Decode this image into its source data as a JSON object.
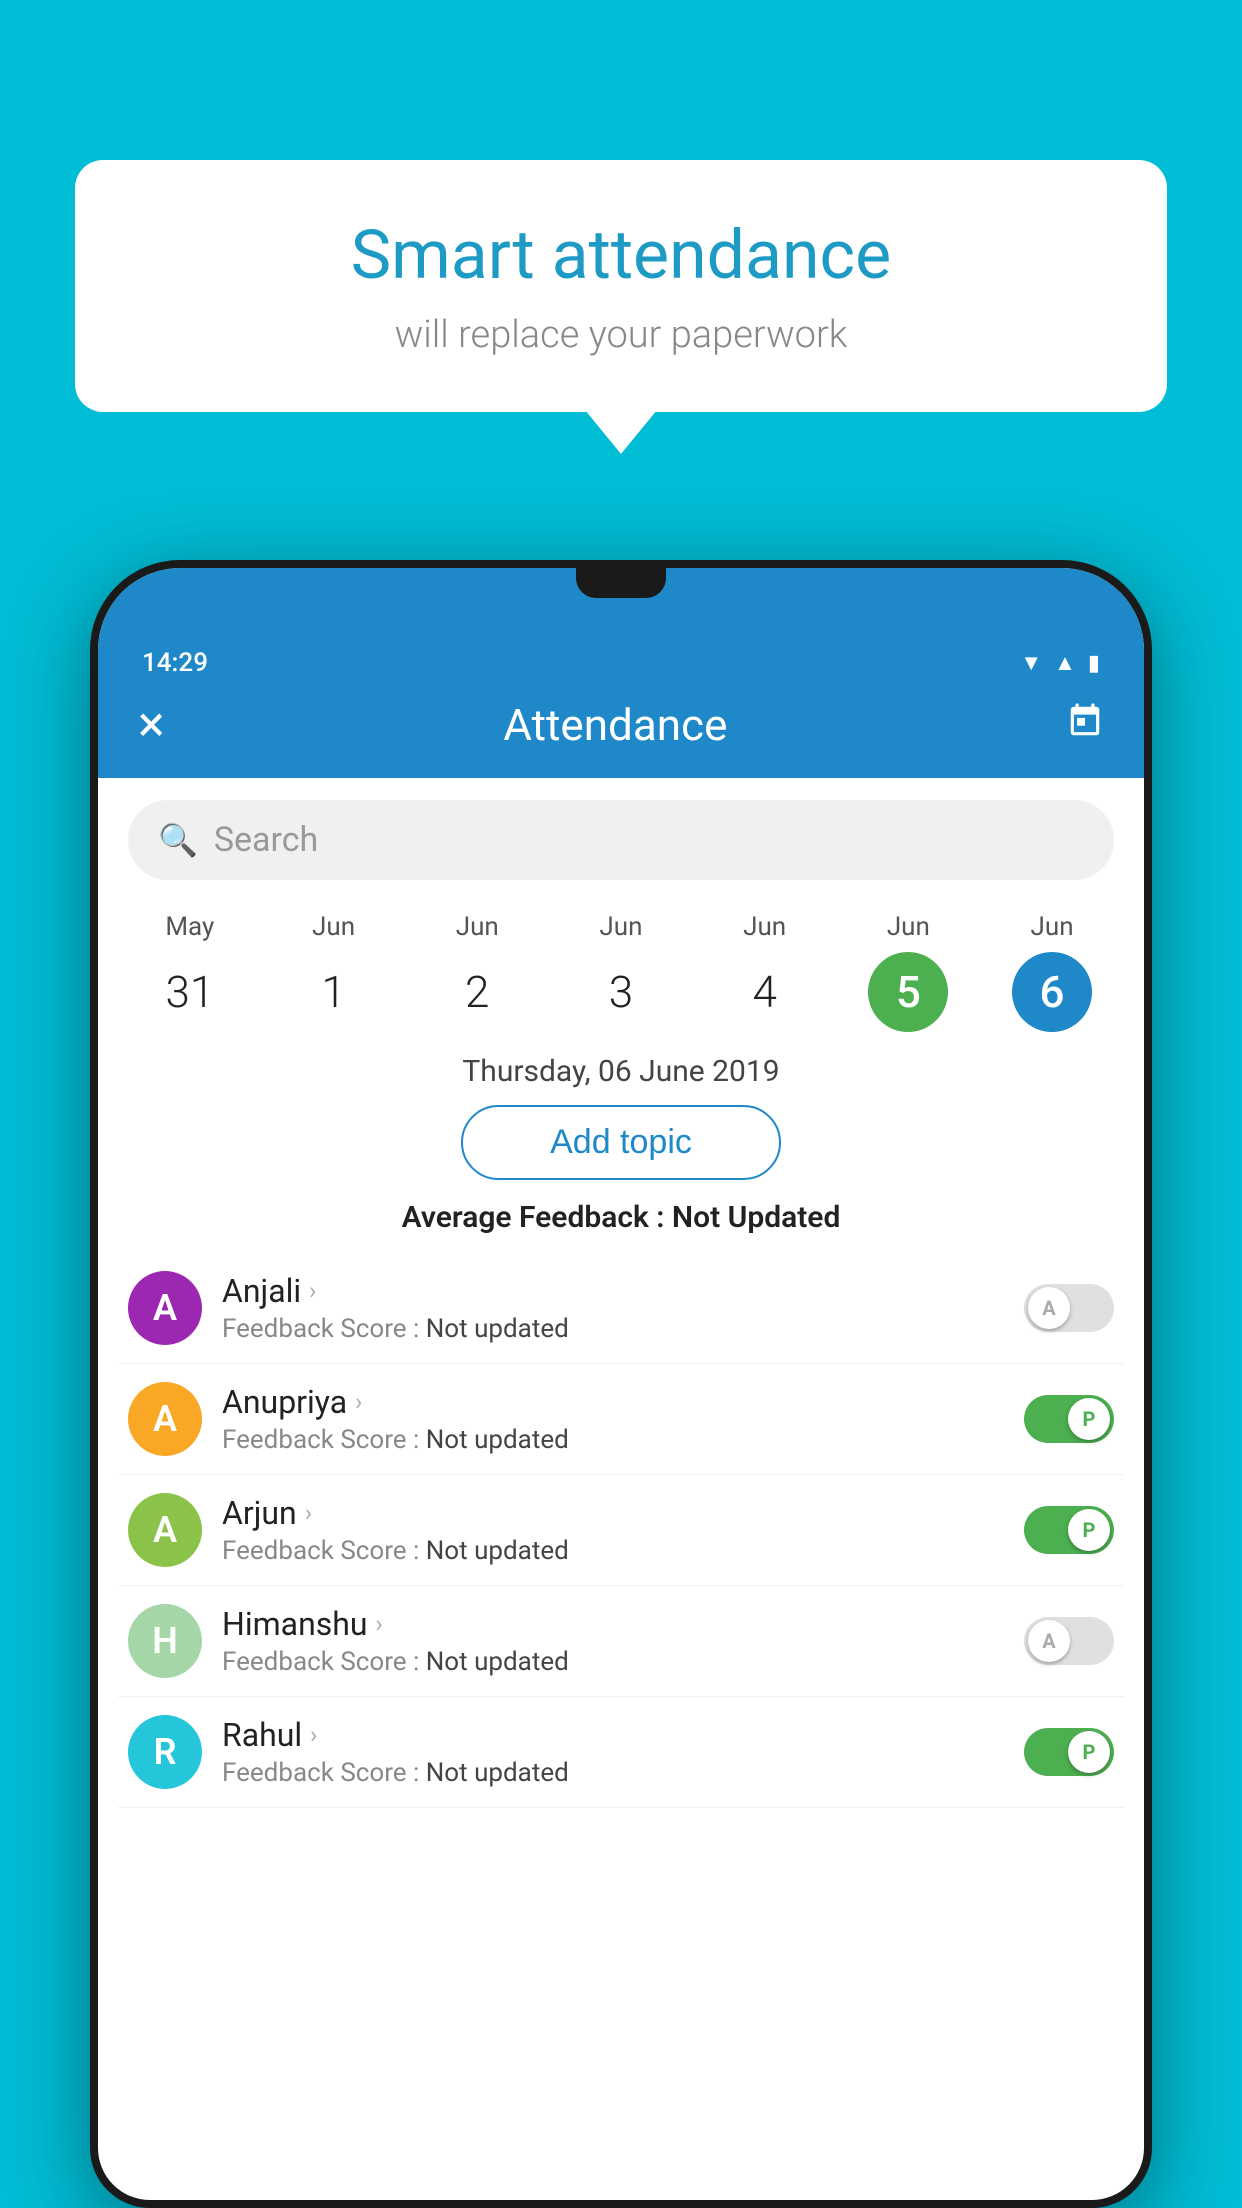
{
  "background_color": "#00bcd4",
  "speech_bubble": {
    "title": "Smart attendance",
    "subtitle": "will replace your paperwork"
  },
  "status_bar": {
    "time": "14:29"
  },
  "app_header": {
    "title": "Attendance",
    "close_label": "×",
    "calendar_label": "📅"
  },
  "search": {
    "placeholder": "Search"
  },
  "calendar": {
    "days": [
      {
        "month": "May",
        "date": "31",
        "style": "normal"
      },
      {
        "month": "Jun",
        "date": "1",
        "style": "normal"
      },
      {
        "month": "Jun",
        "date": "2",
        "style": "normal"
      },
      {
        "month": "Jun",
        "date": "3",
        "style": "normal"
      },
      {
        "month": "Jun",
        "date": "4",
        "style": "normal"
      },
      {
        "month": "Jun",
        "date": "5",
        "style": "today"
      },
      {
        "month": "Jun",
        "date": "6",
        "style": "selected"
      }
    ]
  },
  "selected_date_label": "Thursday, 06 June 2019",
  "add_topic_button": "Add topic",
  "average_feedback": {
    "label": "Average Feedback : ",
    "value": "Not Updated"
  },
  "students": [
    {
      "name": "Anjali",
      "avatar_letter": "A",
      "avatar_color": "#9c27b0",
      "feedback_label": "Feedback Score : ",
      "feedback_value": "Not updated",
      "toggle": "off",
      "toggle_letter": "A"
    },
    {
      "name": "Anupriya",
      "avatar_letter": "A",
      "avatar_color": "#f9a825",
      "feedback_label": "Feedback Score : ",
      "feedback_value": "Not updated",
      "toggle": "on",
      "toggle_letter": "P"
    },
    {
      "name": "Arjun",
      "avatar_letter": "A",
      "avatar_color": "#8bc34a",
      "feedback_label": "Feedback Score : ",
      "feedback_value": "Not updated",
      "toggle": "on",
      "toggle_letter": "P"
    },
    {
      "name": "Himanshu",
      "avatar_letter": "H",
      "avatar_color": "#a5d6a7",
      "feedback_label": "Feedback Score : ",
      "feedback_value": "Not updated",
      "toggle": "off",
      "toggle_letter": "A"
    },
    {
      "name": "Rahul",
      "avatar_letter": "R",
      "avatar_color": "#26c6da",
      "feedback_label": "Feedback Score : ",
      "feedback_value": "Not updated",
      "toggle": "on",
      "toggle_letter": "P"
    }
  ]
}
